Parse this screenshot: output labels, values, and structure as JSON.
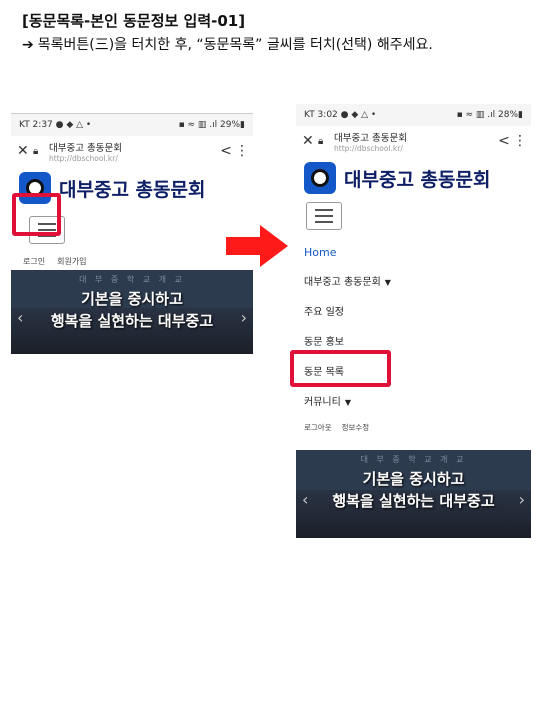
{
  "title": "[동문목록-본인 동문정보 입력-01]",
  "instruction": {
    "arrow": "➔",
    "text": "목록버튼(三)을 터치한 후, “동문목록” 글씨를 터치(선택) 해주세요."
  },
  "left_phone": {
    "status": {
      "carrier": "KT 2:37",
      "icons_left": "● ◆ △ •",
      "icons_right": "▪ ≈ ▥ .ıl",
      "battery": "29%▮"
    },
    "url": {
      "title": "대부중고 총동문회",
      "address": "http://dbschool.kr/"
    },
    "site_name": "대부중고 총동문회",
    "links": [
      "로그인",
      "회원가입"
    ],
    "banner": {
      "line1": "기본을 중시하고",
      "line2": "행복을 실현하는 대부중고",
      "top": "대 부 중 학 교 개 교"
    }
  },
  "right_phone": {
    "status": {
      "carrier": "KT 3:02",
      "icons_left": "● ◆ △ •",
      "icons_right": "▪ ≈ ▥ .ıl",
      "battery": "28%▮"
    },
    "url": {
      "title": "대부중고 총동문회",
      "address": "http://dbschool.kr/"
    },
    "site_name": "대부중고 총동문회",
    "menu": {
      "home": "Home",
      "intro": "대부중고 총동문회",
      "schedule": "주요 일정",
      "promo": "동문 홍보",
      "list": "동문 목록",
      "community": "커뮤니티",
      "sub": [
        "로그아웃",
        "정보수정"
      ]
    },
    "banner": {
      "line1": "기본을 중시하고",
      "line2": "행복을 실현하는 대부중고",
      "top": "대 부 중 학 교 개 교"
    }
  },
  "colors": {
    "highlight": "#e01039",
    "arrow": "#ff1a1a",
    "link": "#1357c9",
    "brand": "#0e1f66"
  },
  "icons": [
    "close-icon",
    "lock-icon",
    "share-icon",
    "more-icon",
    "hamburger-icon",
    "chevron-down-icon",
    "right-arrow-icon"
  ]
}
